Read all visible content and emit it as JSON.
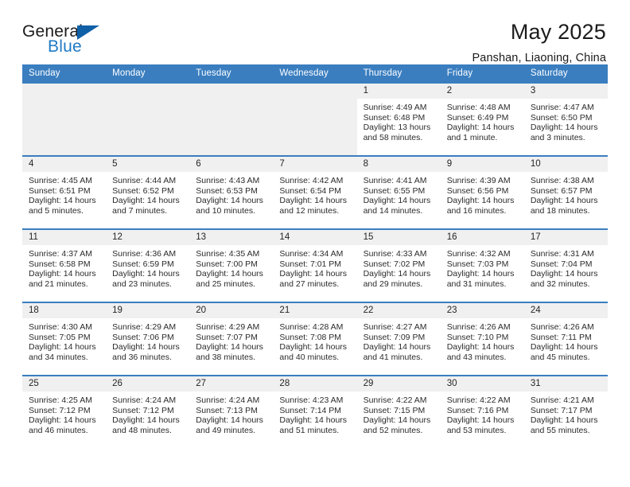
{
  "logo": {
    "word_one": "General",
    "word_two": "Blue",
    "triangle_icon": "triangle-icon"
  },
  "header": {
    "title": "May 2025",
    "location": "Panshan, Liaoning, China"
  },
  "colors": {
    "header_blue": "#3a7ec0",
    "row_border": "#3a7ec0",
    "daynum_band": "#f0f0f0",
    "logo_blue": "#1f7ac4",
    "logo_triangle": "#1060a8",
    "text": "#2b2b2b"
  },
  "calendar": {
    "weekday_headers": [
      "Sunday",
      "Monday",
      "Tuesday",
      "Wednesday",
      "Thursday",
      "Friday",
      "Saturday"
    ],
    "weeks": [
      [
        {
          "day": "",
          "empty": true,
          "lines": []
        },
        {
          "day": "",
          "empty": true,
          "lines": []
        },
        {
          "day": "",
          "empty": true,
          "lines": []
        },
        {
          "day": "",
          "empty": true,
          "lines": []
        },
        {
          "day": "1",
          "empty": false,
          "lines": [
            "Sunrise: 4:49 AM",
            "Sunset: 6:48 PM",
            "Daylight: 13 hours",
            "and 58 minutes."
          ]
        },
        {
          "day": "2",
          "empty": false,
          "lines": [
            "Sunrise: 4:48 AM",
            "Sunset: 6:49 PM",
            "Daylight: 14 hours",
            "and 1 minute."
          ]
        },
        {
          "day": "3",
          "empty": false,
          "lines": [
            "Sunrise: 4:47 AM",
            "Sunset: 6:50 PM",
            "Daylight: 14 hours",
            "and 3 minutes."
          ]
        }
      ],
      [
        {
          "day": "4",
          "empty": false,
          "lines": [
            "Sunrise: 4:45 AM",
            "Sunset: 6:51 PM",
            "Daylight: 14 hours",
            "and 5 minutes."
          ]
        },
        {
          "day": "5",
          "empty": false,
          "lines": [
            "Sunrise: 4:44 AM",
            "Sunset: 6:52 PM",
            "Daylight: 14 hours",
            "and 7 minutes."
          ]
        },
        {
          "day": "6",
          "empty": false,
          "lines": [
            "Sunrise: 4:43 AM",
            "Sunset: 6:53 PM",
            "Daylight: 14 hours",
            "and 10 minutes."
          ]
        },
        {
          "day": "7",
          "empty": false,
          "lines": [
            "Sunrise: 4:42 AM",
            "Sunset: 6:54 PM",
            "Daylight: 14 hours",
            "and 12 minutes."
          ]
        },
        {
          "day": "8",
          "empty": false,
          "lines": [
            "Sunrise: 4:41 AM",
            "Sunset: 6:55 PM",
            "Daylight: 14 hours",
            "and 14 minutes."
          ]
        },
        {
          "day": "9",
          "empty": false,
          "lines": [
            "Sunrise: 4:39 AM",
            "Sunset: 6:56 PM",
            "Daylight: 14 hours",
            "and 16 minutes."
          ]
        },
        {
          "day": "10",
          "empty": false,
          "lines": [
            "Sunrise: 4:38 AM",
            "Sunset: 6:57 PM",
            "Daylight: 14 hours",
            "and 18 minutes."
          ]
        }
      ],
      [
        {
          "day": "11",
          "empty": false,
          "lines": [
            "Sunrise: 4:37 AM",
            "Sunset: 6:58 PM",
            "Daylight: 14 hours",
            "and 21 minutes."
          ]
        },
        {
          "day": "12",
          "empty": false,
          "lines": [
            "Sunrise: 4:36 AM",
            "Sunset: 6:59 PM",
            "Daylight: 14 hours",
            "and 23 minutes."
          ]
        },
        {
          "day": "13",
          "empty": false,
          "lines": [
            "Sunrise: 4:35 AM",
            "Sunset: 7:00 PM",
            "Daylight: 14 hours",
            "and 25 minutes."
          ]
        },
        {
          "day": "14",
          "empty": false,
          "lines": [
            "Sunrise: 4:34 AM",
            "Sunset: 7:01 PM",
            "Daylight: 14 hours",
            "and 27 minutes."
          ]
        },
        {
          "day": "15",
          "empty": false,
          "lines": [
            "Sunrise: 4:33 AM",
            "Sunset: 7:02 PM",
            "Daylight: 14 hours",
            "and 29 minutes."
          ]
        },
        {
          "day": "16",
          "empty": false,
          "lines": [
            "Sunrise: 4:32 AM",
            "Sunset: 7:03 PM",
            "Daylight: 14 hours",
            "and 31 minutes."
          ]
        },
        {
          "day": "17",
          "empty": false,
          "lines": [
            "Sunrise: 4:31 AM",
            "Sunset: 7:04 PM",
            "Daylight: 14 hours",
            "and 32 minutes."
          ]
        }
      ],
      [
        {
          "day": "18",
          "empty": false,
          "lines": [
            "Sunrise: 4:30 AM",
            "Sunset: 7:05 PM",
            "Daylight: 14 hours",
            "and 34 minutes."
          ]
        },
        {
          "day": "19",
          "empty": false,
          "lines": [
            "Sunrise: 4:29 AM",
            "Sunset: 7:06 PM",
            "Daylight: 14 hours",
            "and 36 minutes."
          ]
        },
        {
          "day": "20",
          "empty": false,
          "lines": [
            "Sunrise: 4:29 AM",
            "Sunset: 7:07 PM",
            "Daylight: 14 hours",
            "and 38 minutes."
          ]
        },
        {
          "day": "21",
          "empty": false,
          "lines": [
            "Sunrise: 4:28 AM",
            "Sunset: 7:08 PM",
            "Daylight: 14 hours",
            "and 40 minutes."
          ]
        },
        {
          "day": "22",
          "empty": false,
          "lines": [
            "Sunrise: 4:27 AM",
            "Sunset: 7:09 PM",
            "Daylight: 14 hours",
            "and 41 minutes."
          ]
        },
        {
          "day": "23",
          "empty": false,
          "lines": [
            "Sunrise: 4:26 AM",
            "Sunset: 7:10 PM",
            "Daylight: 14 hours",
            "and 43 minutes."
          ]
        },
        {
          "day": "24",
          "empty": false,
          "lines": [
            "Sunrise: 4:26 AM",
            "Sunset: 7:11 PM",
            "Daylight: 14 hours",
            "and 45 minutes."
          ]
        }
      ],
      [
        {
          "day": "25",
          "empty": false,
          "lines": [
            "Sunrise: 4:25 AM",
            "Sunset: 7:12 PM",
            "Daylight: 14 hours",
            "and 46 minutes."
          ]
        },
        {
          "day": "26",
          "empty": false,
          "lines": [
            "Sunrise: 4:24 AM",
            "Sunset: 7:12 PM",
            "Daylight: 14 hours",
            "and 48 minutes."
          ]
        },
        {
          "day": "27",
          "empty": false,
          "lines": [
            "Sunrise: 4:24 AM",
            "Sunset: 7:13 PM",
            "Daylight: 14 hours",
            "and 49 minutes."
          ]
        },
        {
          "day": "28",
          "empty": false,
          "lines": [
            "Sunrise: 4:23 AM",
            "Sunset: 7:14 PM",
            "Daylight: 14 hours",
            "and 51 minutes."
          ]
        },
        {
          "day": "29",
          "empty": false,
          "lines": [
            "Sunrise: 4:22 AM",
            "Sunset: 7:15 PM",
            "Daylight: 14 hours",
            "and 52 minutes."
          ]
        },
        {
          "day": "30",
          "empty": false,
          "lines": [
            "Sunrise: 4:22 AM",
            "Sunset: 7:16 PM",
            "Daylight: 14 hours",
            "and 53 minutes."
          ]
        },
        {
          "day": "31",
          "empty": false,
          "lines": [
            "Sunrise: 4:21 AM",
            "Sunset: 7:17 PM",
            "Daylight: 14 hours",
            "and 55 minutes."
          ]
        }
      ]
    ]
  }
}
